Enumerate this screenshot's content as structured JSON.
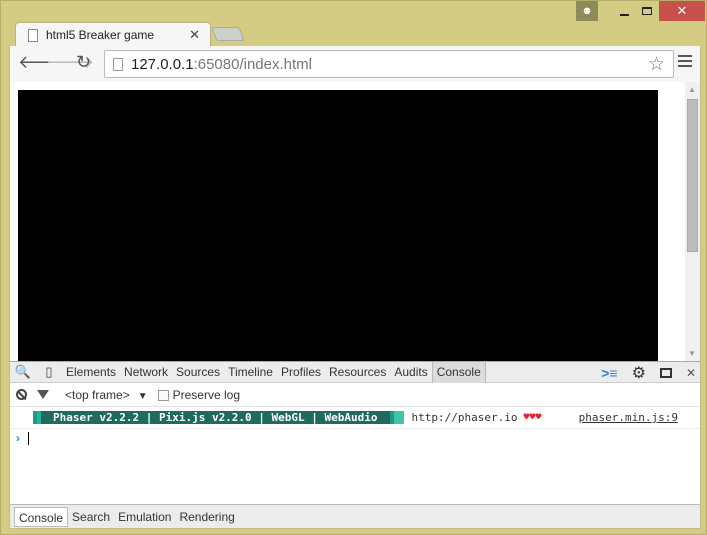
{
  "window": {
    "user_icon": "user-icon",
    "minimize": "minimize",
    "maximize": "maximize",
    "close": "✕"
  },
  "tab": {
    "title": "html5 Breaker game",
    "close": "✕"
  },
  "toolbar": {
    "back": "🡐",
    "forward": "🡒",
    "reload": "↻",
    "url_host": "127.0.0.1",
    "url_rest": ":65080/index.html",
    "star": "☆"
  },
  "devtools": {
    "tabs": [
      "Elements",
      "Network",
      "Sources",
      "Timeline",
      "Profiles",
      "Resources",
      "Audits",
      "Console"
    ],
    "active_tab": "Console",
    "frame_selector": "<top frame>",
    "preserve_log_label": "Preserve log",
    "preserve_log_checked": false,
    "log": {
      "banner": "Phaser v2.2.2 | Pixi.js v2.2.0 | WebGL | WebAudio",
      "url": "http://phaser.io",
      "hearts": "♥♥♥",
      "source": "phaser.min.js:9"
    },
    "prompt": "›",
    "drawer_tabs": [
      "Console",
      "Search",
      "Emulation",
      "Rendering"
    ],
    "drawer_active": "Console",
    "close": "✕"
  }
}
